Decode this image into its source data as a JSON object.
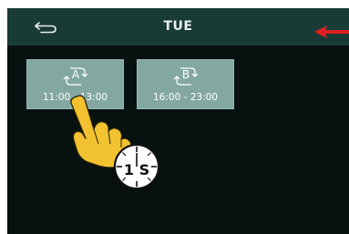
{
  "header": {
    "back_icon": "back-arrow-icon",
    "title": "TUE"
  },
  "slots": [
    {
      "letter": "A",
      "time": "11:00 - 13:00",
      "icon": "cycle-icon"
    },
    {
      "letter": "B",
      "time": "16:00 - 23:00",
      "icon": "cycle-icon"
    }
  ],
  "overlay": {
    "timer_label": "1 S",
    "hand_icon": "tap-hand-icon",
    "arrow_icon": "red-arrow-icon"
  },
  "colors": {
    "header_bg": "#193b36",
    "screen_bg": "#07110f",
    "slot_bg": "#83a8a2",
    "hand": "#f2c230",
    "arrow": "#e02020"
  }
}
